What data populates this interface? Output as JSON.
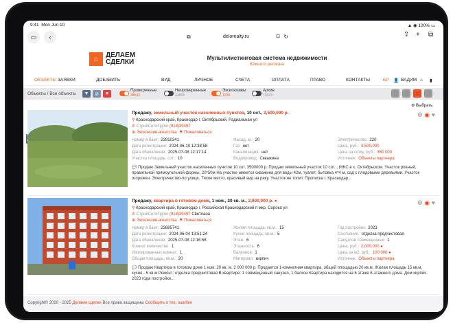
{
  "status": {
    "time": "9:41",
    "date": "Mon Jun 10",
    "battery": "100%"
  },
  "browser": {
    "url": "delorealty.ru"
  },
  "site": {
    "logo_text_1": "ДЕЛАЕМ",
    "logo_text_2": "СДЕЛКИ",
    "title": "Мультилистинговая система недвижимости",
    "subtitle": "Южного региона"
  },
  "nav": {
    "objects": "ОБЪЕКТЫ",
    "requests": "ЗАЯВКИ",
    "add": "ДОБАВИТЬ",
    "view": "ВИД",
    "personal": "ЛИЧНОЕ",
    "accounts": "СЧЕТА",
    "payment": "ОПЛАТА",
    "law": "ПРАВО",
    "contacts": "КОНТАКТЫ",
    "bp": "БР",
    "user": "ВАДИМ"
  },
  "toolbar": {
    "breadcrumb": "Объекты / Все объекты",
    "toggles": [
      {
        "label": "Проверенные",
        "count": "38543",
        "on": true
      },
      {
        "label": "Непроверенные",
        "count": "44858",
        "on": false
      },
      {
        "label": "Эксклюзивы",
        "count": "1236",
        "on": true
      },
      {
        "label": "Архив",
        "count": "73423",
        "on": false
      }
    ]
  },
  "select_label": "Выбрать",
  "listings": [
    {
      "title_prefix": "Продажу,",
      "title_type": "земельный участок населенных пунктов",
      "title_size": ", 10 сот.,",
      "title_price": "3,500,000 р.",
      "address": "Краснодарский край, Краснодар г, Октябрьский, Радиальная ул",
      "agency": "СтройСитиГрупп",
      "phone": "(918)39497",
      "exclusive": "Эксклюзив агентства",
      "complain": "Пожаловаться",
      "fields_col1": [
        {
          "k": "Номер в базе:",
          "v": "23910341"
        },
        {
          "k": "Дата регистрации:",
          "v": "2024-06-10 12:38:58"
        },
        {
          "k": "Дата обновления:",
          "v": "2025-07-08 12:17:14"
        },
        {
          "k": "Участка площадь, сот.:",
          "v": "10"
        }
      ],
      "fields_col2": [
        {
          "k": "Фасад, м.:",
          "v": "20"
        },
        {
          "k": "Газ:",
          "v": "нет"
        },
        {
          "k": "Канализация:",
          "v": "нет"
        },
        {
          "k": "Водопровод:",
          "v": "Скважина"
        }
      ],
      "fields_col3": [
        {
          "k": "Электричество:",
          "v": "220",
          "o": false
        },
        {
          "k": "Цена, руб.:",
          "v": "3,500,000",
          "o": true
        },
        {
          "k": "Цена за сотку, руб.:",
          "v": "350 000",
          "o": true
        },
        {
          "k": "Источник:",
          "v": "Объекты партнера",
          "o": true
        }
      ],
      "description": "Продаю Земельный участок населенных пунктов 10 сот. 3500000 р. Продам земельный участок 10 сот. , ИЖС в х. Октябрьском. Участок ровный, правильной прямоугольной формы, 20*50м На участке имеется скважина для воды 42м, туалет, бытовка 4*4 м, сад с плодовыми деревьями. Участок огорожен. Электричество-по улице. Тихое место, красивый вид на реку. Участок не топит. Прописка г. Краснодар..."
    },
    {
      "title_prefix": "Продажу,",
      "title_type": "квартира в готовом доме",
      "title_size": ", 1 ком., 20 кв. м.,",
      "title_price": "2,000,000 р. ●",
      "address": "Краснодарский край, Краснодар г, Российская Краснодарский п мкр, Сорока ул",
      "agency": "СтройСитиГрупп",
      "phone": "(918)39497",
      "contact": "Светлана",
      "exclusive": "Эксклюзив агентства",
      "complain": "Пожаловаться",
      "fields_col1": [
        {
          "k": "Номер в базе:",
          "v": "23885741"
        },
        {
          "k": "Дата регистрации:",
          "v": "2024-06-04 13:51:24"
        },
        {
          "k": "Дата обновления:",
          "v": "2025-07-08 12:16:58"
        },
        {
          "k": "Комнат количество:",
          "v": "1"
        },
        {
          "k": "Изолированных комнат:",
          "v": "1"
        },
        {
          "k": "Общая площадь, кв.м.:",
          "v": "20"
        }
      ],
      "fields_col2": [
        {
          "k": "Жилая площадь, кв.м.:",
          "v": "15"
        },
        {
          "k": "Кухни площадь, кв.м.:",
          "v": "5"
        },
        {
          "k": "Этаж:",
          "v": "6"
        },
        {
          "k": "Этажность:",
          "v": "6"
        },
        {
          "k": "Балконов:",
          "v": "1"
        },
        {
          "k": "Материал:",
          "v": "кирпич"
        }
      ],
      "fields_col3": [
        {
          "k": "Год постройки:",
          "v": "2023",
          "o": false
        },
        {
          "k": "Состояние:",
          "v": "отделка предчистовая",
          "o": false
        },
        {
          "k": "Санузлов совмещенных:",
          "v": "1",
          "o": false
        },
        {
          "k": "Цена, руб.:",
          "v": "2,000,000 ●",
          "o": true
        },
        {
          "k": "Цена за м2, руб.:",
          "v": "100 000 ●",
          "o": true
        },
        {
          "k": "Источник:",
          "v": "Объекты партнера",
          "o": true
        }
      ],
      "description": "Продаю Квартира в готовом доме 1 ком. 20 кв. м. 2 000 000 р. Продается 1-комнатная квартира, общей площадью 20 кв.м. Жилая площадь 15 кв.м, кухня - 5 кв.м Ремонт: отделка предчистовая В квартире: 1 совмещенный санузел, 1 балкон Квартира находится на 6 этаже 6-этажного дома. Дом кирпич. 2023 года постройки..."
    }
  ],
  "footer": {
    "copyright": "Copyright© 2020 - 2025",
    "brand": "Делаем сделки",
    "rights": "Все права защищены",
    "report": "Сообщить о тех. ошибке"
  }
}
